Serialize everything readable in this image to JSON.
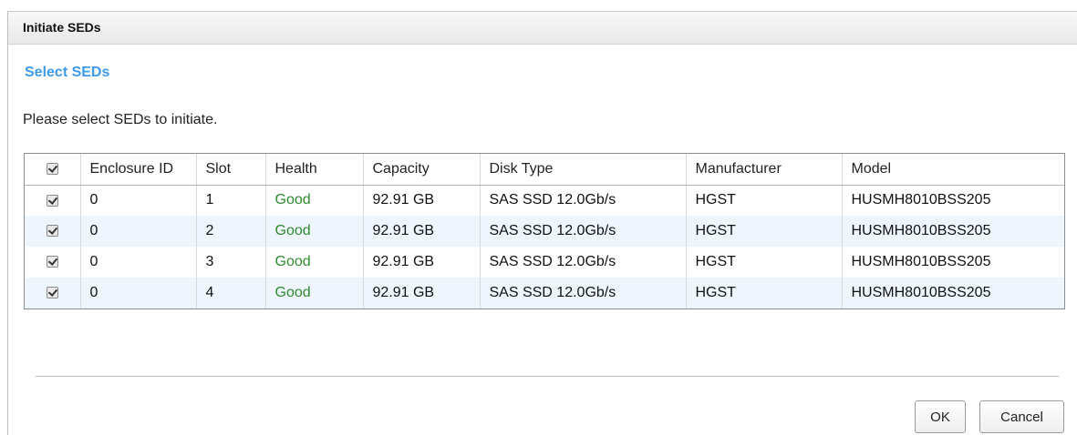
{
  "dialog": {
    "title": "Initiate SEDs",
    "section_title": "Select SEDs",
    "instruction": "Please select SEDs to initiate."
  },
  "table": {
    "select_all_checked": true,
    "headers": [
      "Enclosure ID",
      "Slot",
      "Health",
      "Capacity",
      "Disk Type",
      "Manufacturer",
      "Model"
    ],
    "rows": [
      {
        "checked": true,
        "enclosure_id": "0",
        "slot": "1",
        "health": "Good",
        "capacity": "92.91 GB",
        "disk_type": "SAS SSD 12.0Gb/s",
        "manufacturer": "HGST",
        "model": "HUSMH8010BSS205"
      },
      {
        "checked": true,
        "enclosure_id": "0",
        "slot": "2",
        "health": "Good",
        "capacity": "92.91 GB",
        "disk_type": "SAS SSD 12.0Gb/s",
        "manufacturer": "HGST",
        "model": "HUSMH8010BSS205"
      },
      {
        "checked": true,
        "enclosure_id": "0",
        "slot": "3",
        "health": "Good",
        "capacity": "92.91 GB",
        "disk_type": "SAS SSD 12.0Gb/s",
        "manufacturer": "HGST",
        "model": "HUSMH8010BSS205"
      },
      {
        "checked": true,
        "enclosure_id": "0",
        "slot": "4",
        "health": "Good",
        "capacity": "92.91 GB",
        "disk_type": "SAS SSD 12.0Gb/s",
        "manufacturer": "HGST",
        "model": "HUSMH8010BSS205"
      }
    ]
  },
  "buttons": {
    "ok": "OK",
    "cancel": "Cancel"
  },
  "colors": {
    "section_title": "#3d9be9",
    "health_good": "#2f8a2f",
    "alt_row": "#eef5fd"
  }
}
